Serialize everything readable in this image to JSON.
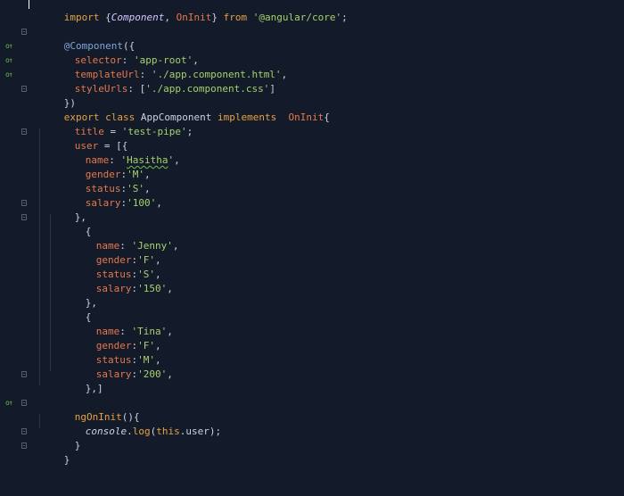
{
  "editor": {
    "theme": {
      "background": "#131a2a",
      "keyword": "#e8a23e",
      "string": "#a7d26b",
      "property": "#e8784a",
      "decorator": "#7fa6d6"
    },
    "gutter_marker_text": "o↑",
    "lines": {
      "l1": {
        "kw_import": "import",
        "brace_open": " {",
        "cls_component": "Component",
        "comma": ", ",
        "iface_oninit": "OnInit",
        "brace_close": "} ",
        "kw_from": "from",
        "space": " ",
        "str_core": "'@angular/core'",
        "semi": ";"
      },
      "l3": {
        "decorator": "@Component",
        "open": "({"
      },
      "l4": {
        "prop": "selector",
        "colon": ": ",
        "str": "'app-root'",
        "comma": ","
      },
      "l5": {
        "prop": "templateUrl",
        "colon": ": ",
        "str": "'./app.component.html'",
        "comma": ","
      },
      "l6": {
        "prop": "styleUrls",
        "colon": ": [",
        "str": "'./app.component.css'",
        "close": "]"
      },
      "l7": {
        "text": "})"
      },
      "l8": {
        "kw_export": "export",
        "kw_class": " class ",
        "cls_name": "AppComponent",
        "kw_impl": " implements ",
        "iface": " OnInit",
        "brace": "{"
      },
      "l9": {
        "prop": "title",
        "eq": " = ",
        "str": "'test-pipe'",
        "semi": ";"
      },
      "l10": {
        "prop": "user",
        "eq": " = [{"
      },
      "l11": {
        "prop": "name",
        "colon": ": ",
        "str_q1": "'",
        "str_typo": "Hasitha",
        "str_q2": "'",
        "comma": ","
      },
      "l12": {
        "prop": "gender",
        "colon": ":",
        "str": "'M'",
        "comma": ","
      },
      "l13": {
        "prop": "status",
        "colon": ":",
        "str": "'S'",
        "comma": ","
      },
      "l14": {
        "prop": "salary",
        "colon": ":",
        "str": "'100'",
        "comma": ","
      },
      "l15": {
        "text": "},"
      },
      "l16": {
        "text": "{"
      },
      "l17": {
        "prop": "name",
        "colon": ": ",
        "str": "'Jenny'",
        "comma": ","
      },
      "l18": {
        "prop": "gender",
        "colon": ":",
        "str": "'F'",
        "comma": ","
      },
      "l19": {
        "prop": "status",
        "colon": ":",
        "str": "'S'",
        "comma": ","
      },
      "l20": {
        "prop": "salary",
        "colon": ":",
        "str": "'150'",
        "comma": ","
      },
      "l21": {
        "text": "},"
      },
      "l22": {
        "text": "{"
      },
      "l23": {
        "prop": "name",
        "colon": ": ",
        "str": "'Tina'",
        "comma": ","
      },
      "l24": {
        "prop": "gender",
        "colon": ":",
        "str": "'F'",
        "comma": ","
      },
      "l25": {
        "prop": "status",
        "colon": ":",
        "str": "'M'",
        "comma": ","
      },
      "l26": {
        "prop": "salary",
        "colon": ":",
        "str": "'200'",
        "comma": ","
      },
      "l27": {
        "text": "},]"
      },
      "l29": {
        "fn": "ngOnInit",
        "paren": "(){"
      },
      "l30": {
        "obj": "console",
        "dot": ".",
        "fn": "log",
        "open": "(",
        "this": "this",
        "rest": ".user);"
      },
      "l31": {
        "text": "}"
      },
      "l32": {
        "text": "}"
      }
    }
  }
}
